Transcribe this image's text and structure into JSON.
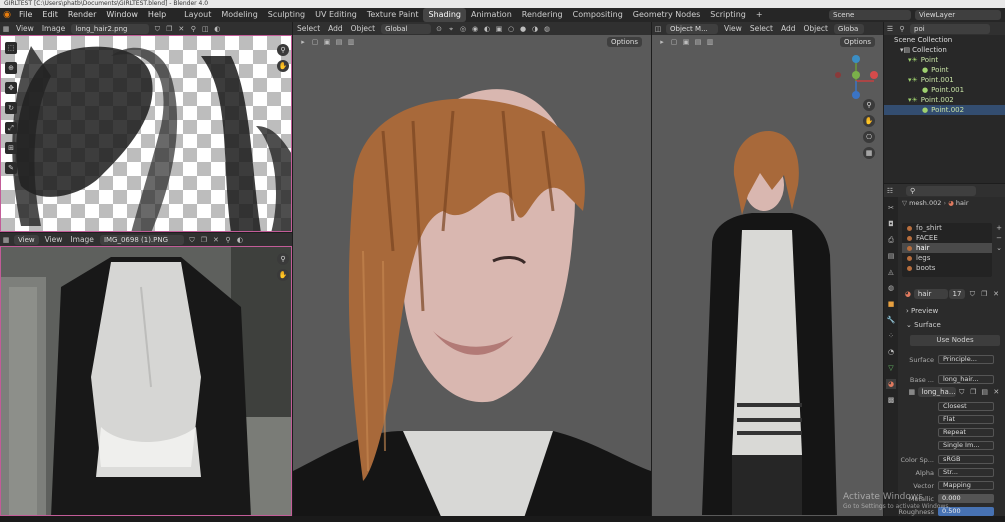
{
  "window": {
    "title": "GIRLTEST [C:\\Users\\phatb\\Documents\\GIRLTEST.blend] - Blender 4.0"
  },
  "menu": {
    "items": [
      "File",
      "Edit",
      "Render",
      "Window",
      "Help"
    ]
  },
  "workspaces": {
    "tabs": [
      "Layout",
      "Modeling",
      "Sculpting",
      "UV Editing",
      "Texture Paint",
      "Shading",
      "Animation",
      "Rendering",
      "Compositing",
      "Geometry Nodes",
      "Scripting"
    ],
    "active": "Shading",
    "add": "+"
  },
  "scene": {
    "name": "Scene",
    "view_layer": "ViewLayer"
  },
  "image_editor_top": {
    "menu": [
      "View",
      "Image"
    ],
    "image_name": "long_hair2.png"
  },
  "image_editor_bottom": {
    "mode": "View",
    "menu": [
      "View",
      "Image"
    ],
    "image_name": "IMG_0698 (1).PNG"
  },
  "viewport_main": {
    "menu": [
      "Select",
      "Add",
      "Object"
    ],
    "orientation": "Global",
    "options": "Options"
  },
  "viewport_right": {
    "mode": "Object M...",
    "menu": [
      "View",
      "Select",
      "Add",
      "Object"
    ],
    "orientation": "Globa",
    "options": "Options"
  },
  "outliner": {
    "search": "poi",
    "items": [
      {
        "label": "Scene Collection",
        "indent": 0
      },
      {
        "label": "Collection",
        "indent": 1
      },
      {
        "label": "Point",
        "indent": 2
      },
      {
        "label": "Point",
        "indent": 3
      },
      {
        "label": "Point.001",
        "indent": 2
      },
      {
        "label": "Point.001",
        "indent": 3
      },
      {
        "label": "Point.002",
        "indent": 2
      },
      {
        "label": "Point.002",
        "indent": 3
      }
    ]
  },
  "properties": {
    "breadcrumb": {
      "object": "mesh.002",
      "material": "hair"
    },
    "material_slots": [
      "fo_shirt",
      "FACEE",
      "hair",
      "legs",
      "boots"
    ],
    "active_slot": "hair",
    "material_name": "hair",
    "users": "17",
    "sections": {
      "preview": "Preview",
      "surface": "Surface"
    },
    "use_nodes": "Use Nodes",
    "surface_label": "Surface",
    "surface_value": "Principle...",
    "base_color_label": "Base ...",
    "base_color_value": "long_hair...",
    "image_name": "long_ha...",
    "interpolation": "Closest",
    "projection": "Flat",
    "extension": "Repeat",
    "source": "Single Im...",
    "color_space_label": "Color Sp...",
    "color_space_value": "sRGB",
    "alpha_label": "Alpha",
    "alpha_value": "Str...",
    "vector_label": "Vector",
    "vector_value": "Mapping",
    "metallic_label": "Metallic",
    "metallic_value": "0.000",
    "roughness_label": "Roughness",
    "roughness_value": "0.500"
  },
  "watermark": {
    "line1": "Activate Windows",
    "line2": "Go to Settings to activate Windows."
  },
  "colors": {
    "accent": "#c25c98",
    "active_ws": "#454545",
    "hair": "#a8693a",
    "viewport_bg": "#5a5a5a"
  }
}
